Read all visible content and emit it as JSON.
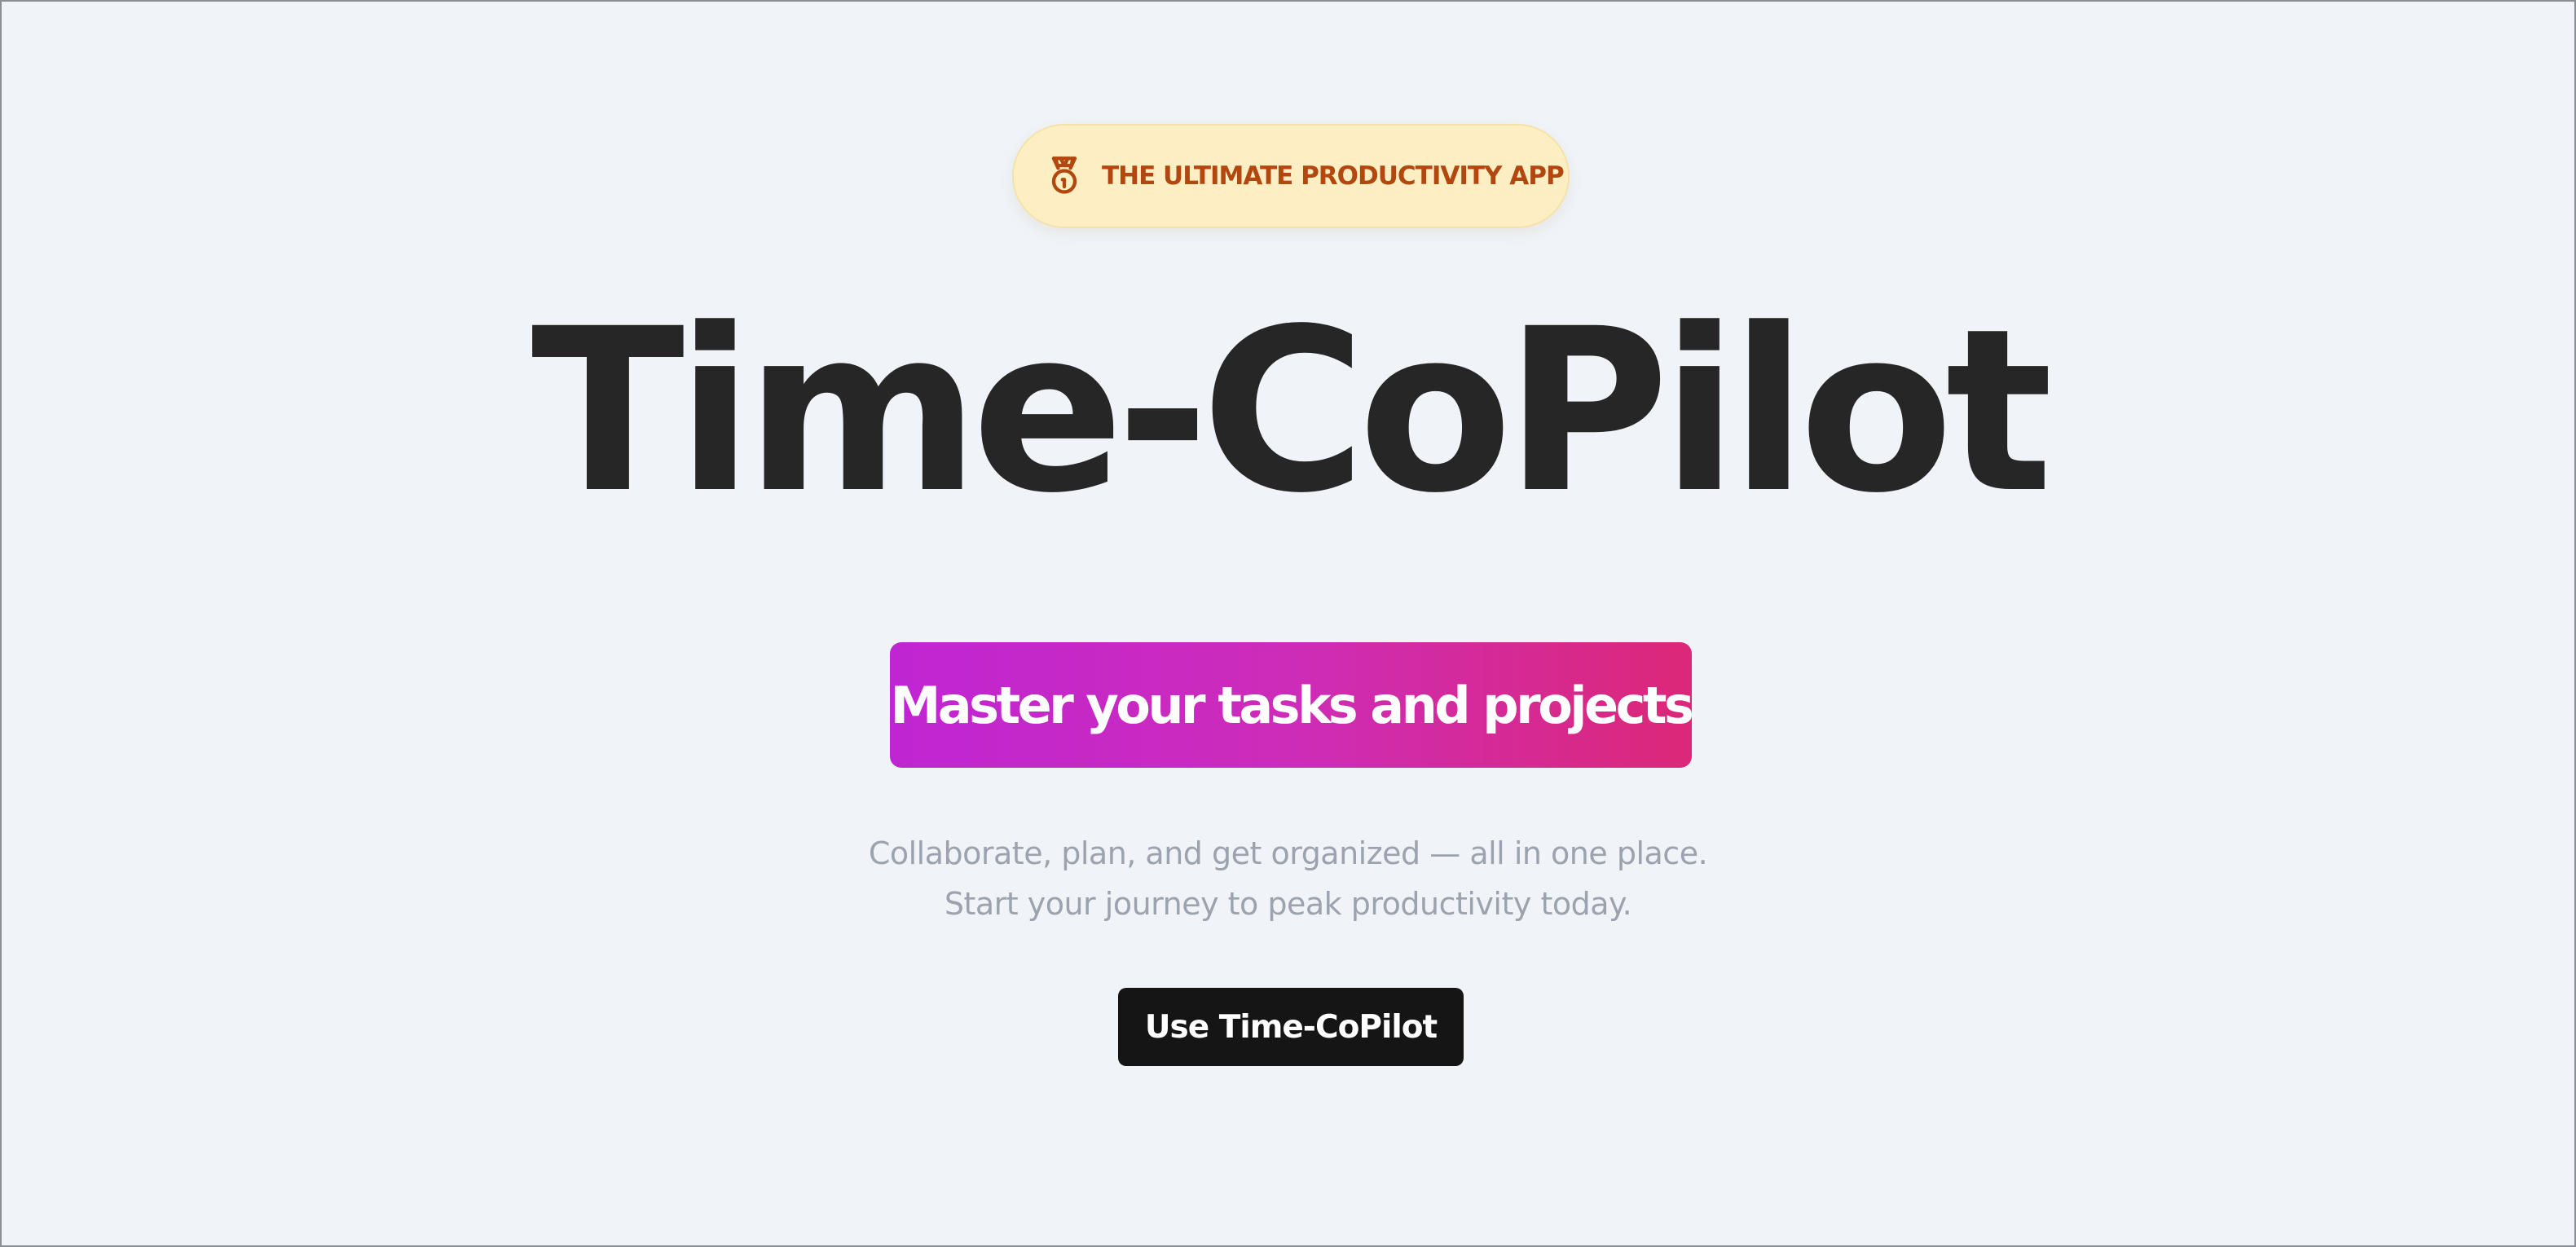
{
  "badge": {
    "icon": "medal-icon",
    "text": "THE ULTIMATE PRODUCTIVITY APP"
  },
  "hero": {
    "title": "Time-CoPilot",
    "tagline": "Master your tasks and projects",
    "subtitle_line1": "Collaborate, plan, and get organized — all in one place.",
    "subtitle_line2": "Start your journey to peak productivity today."
  },
  "cta": {
    "label": "Use Time-CoPilot"
  },
  "colors": {
    "background": "#f0f4f9",
    "badge_bg": "#fdefc3",
    "badge_text": "#b2470f",
    "title": "#262626",
    "gradient_start": "#c025d3",
    "gradient_end": "#dc2878",
    "subtitle": "#9ca3af",
    "cta_bg": "#151515"
  }
}
